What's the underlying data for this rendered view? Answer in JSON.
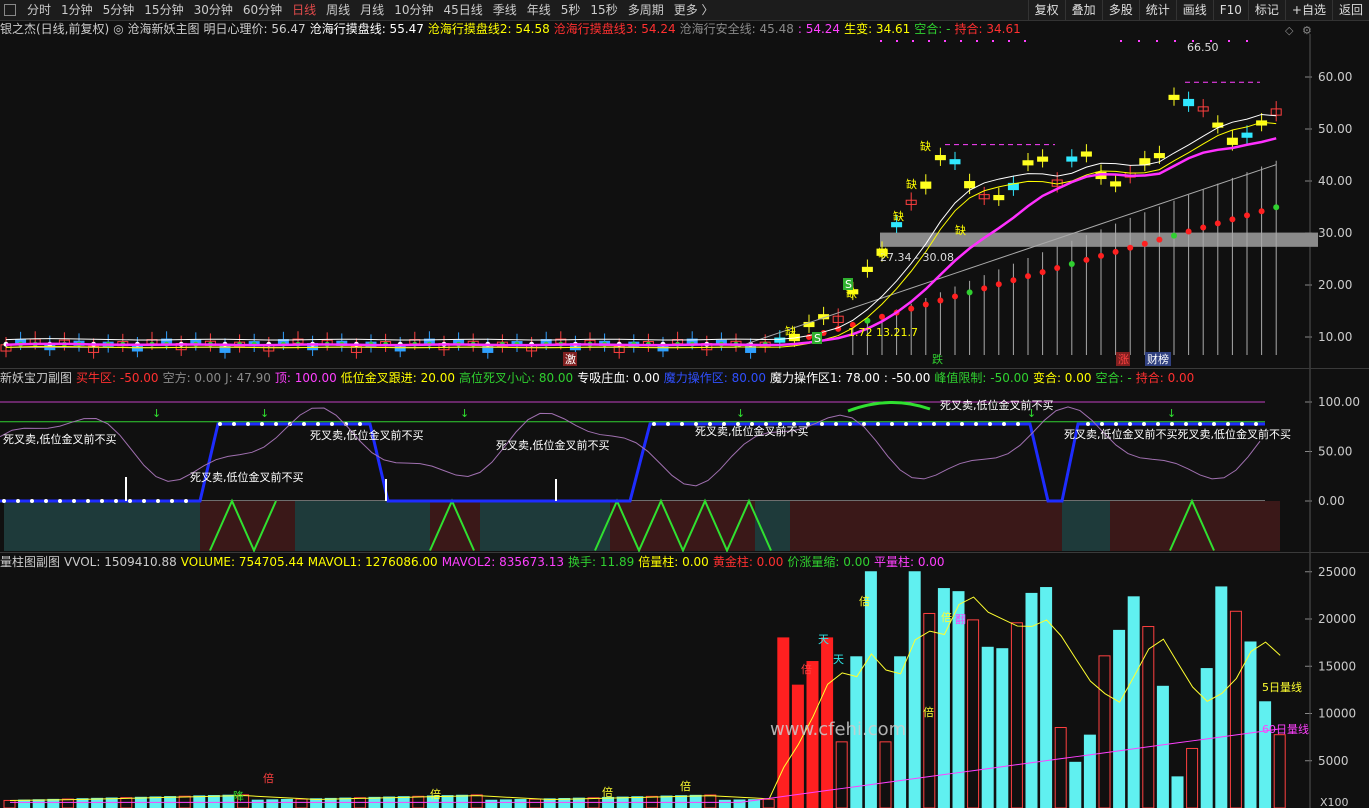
{
  "toolbar": {
    "periods": [
      "分时",
      "1分钟",
      "5分钟",
      "15分钟",
      "30分钟",
      "60分钟",
      "日线",
      "周线",
      "月线",
      "10分钟",
      "45日线",
      "季线",
      "年线",
      "5秒",
      "15秒",
      "多周期",
      "更多 〉"
    ],
    "active_period": "日线",
    "tools": [
      "复权",
      "叠加",
      "多股",
      "统计",
      "画线",
      "F10",
      "标记",
      "+自选",
      "返回"
    ]
  },
  "main_panel": {
    "legend": [
      {
        "text": "银之杰(日线,前复权)",
        "color": "#cccccc"
      },
      {
        "text": "◎ 沧海新妖主图",
        "color": "#cccccc"
      },
      {
        "text": "明日心理价: 56.47",
        "color": "#cccccc"
      },
      {
        "text": "沧海行摸盘线: 55.47",
        "color": "#ffffff"
      },
      {
        "text": "沧海行摸盘线2: 54.58",
        "color": "#ffff00"
      },
      {
        "text": "沧海行摸盘线3: 54.24",
        "color": "#ff3030"
      },
      {
        "text": "沧海行安全线: 45.48",
        "color": "#8a8a8a"
      },
      {
        "text": ": 54.24",
        "color": "#ff40ff"
      },
      {
        "text": "生变: 34.61",
        "color": "#ffff00"
      },
      {
        "text": "空合: -",
        "color": "#30d030"
      },
      {
        "text": "持合: 34.61",
        "color": "#ff3030"
      }
    ],
    "y_ticks": [
      "60.00",
      "50.00",
      "40.00",
      "30.00",
      "20.00",
      "10.00"
    ],
    "annotations": {
      "high_label": "66.50",
      "zone_label": "27.34 - 30.08",
      "low_labels": "1.72 13.21.7",
      "markers": [
        "缺",
        "缺",
        "缺",
        "缺",
        "缺",
        "缺",
        "跌",
        "缺",
        "涨",
        "财榜",
        "激"
      ]
    }
  },
  "sub1_panel": {
    "legend": [
      {
        "text": "新妖宝刀副图",
        "color": "#cccccc"
      },
      {
        "text": "买牛区: -50.00",
        "color": "#ff3030"
      },
      {
        "text": "空方: 0.00",
        "color": "#8a8a8a"
      },
      {
        "text": "J: 47.90",
        "color": "#8a8a8a"
      },
      {
        "text": "顶: 100.00",
        "color": "#ff40ff"
      },
      {
        "text": "低位金叉跟进: 20.00",
        "color": "#ffff00"
      },
      {
        "text": "高位死叉小心: 80.00",
        "color": "#30d030"
      },
      {
        "text": "专吸庄血: 0.00",
        "color": "#ffffff"
      },
      {
        "text": "魔力操作区: 80.00",
        "color": "#3050ff"
      },
      {
        "text": "魔力操作区1: 78.00",
        "color": "#ffffff"
      },
      {
        "text": ": -50.00",
        "color": "#ffffff"
      },
      {
        "text": "峰值限制: -50.00",
        "color": "#30d030"
      },
      {
        "text": "变合: 0.00",
        "color": "#ffff00"
      },
      {
        "text": "空合: -",
        "color": "#30d030"
      },
      {
        "text": "持合: 0.00",
        "color": "#ff3030"
      }
    ],
    "y_ticks": [
      "100.00",
      "50.00",
      "0.00"
    ],
    "texts": [
      "死叉卖,低位金叉前不买",
      "死叉卖,低位金叉前不买",
      "死叉卖,低位金叉前不买",
      "死叉卖,低位金叉前不买",
      "死叉卖,低位金叉前不买",
      "死叉卖,低位金叉前不买",
      "死叉卖,低位金叉前不买死叉卖,低位金叉前不买"
    ]
  },
  "sub2_panel": {
    "legend": [
      {
        "text": "量柱图副图",
        "color": "#cccccc"
      },
      {
        "text": "VVOL: 1509410.88",
        "color": "#cccccc"
      },
      {
        "text": "VOLUME: 754705.44",
        "color": "#ffff00"
      },
      {
        "text": "MAVOL1: 1276086.00",
        "color": "#ffff00"
      },
      {
        "text": "MAVOL2: 835673.13",
        "color": "#ff40ff"
      },
      {
        "text": "换手: 11.89",
        "color": "#30d030"
      },
      {
        "text": "倍量柱: 0.00",
        "color": "#ffff00"
      },
      {
        "text": "黄金柱: 0.00",
        "color": "#ff3030"
      },
      {
        "text": "价涨量缩: 0.00",
        "color": "#30d030"
      },
      {
        "text": "平量柱: 0.00",
        "color": "#ff40ff"
      }
    ],
    "y_ticks": [
      "25000",
      "20000",
      "15000",
      "10000",
      "5000"
    ],
    "line_labels": {
      "ma5": "5日量线",
      "ma60": "60日量线"
    },
    "unit": "X100",
    "watermark": "www.cfehi.com",
    "markers": [
      "倍",
      "天",
      "天",
      "倍",
      "倍",
      "倍",
      "倍",
      "倍",
      "倍",
      "翻",
      "降",
      "倍"
    ]
  }
}
